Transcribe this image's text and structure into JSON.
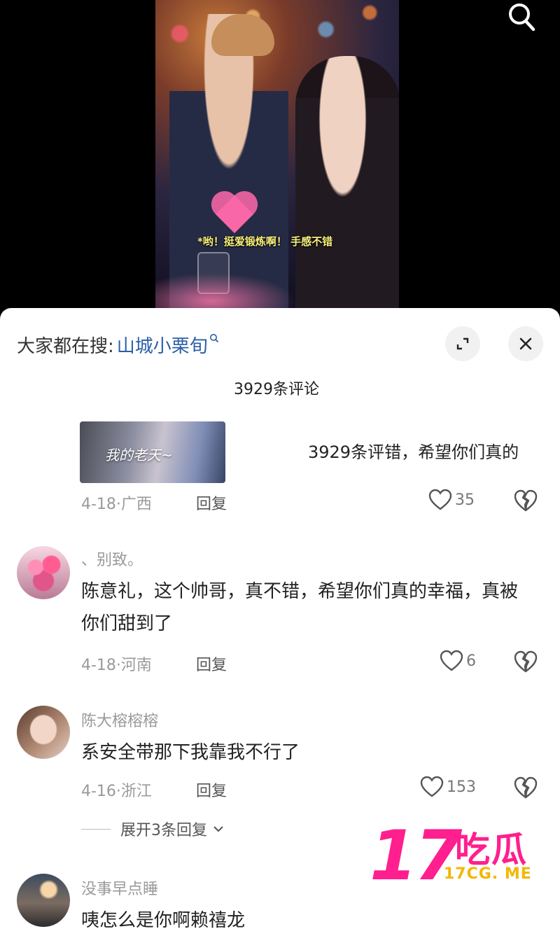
{
  "video": {
    "subtitle": "*哟！挺爱锻炼啊！ 手感不错"
  },
  "header": {
    "search_prefix": "大家都在搜:",
    "search_term": "山城小栗旬",
    "comment_count": "3929条评论"
  },
  "first_comment": {
    "thumbnail_text": "我的老天~",
    "overlay_text": "3929条评错，希望你们真的",
    "date_location": "4-18·广西",
    "reply": "回复",
    "likes": "35"
  },
  "comments": [
    {
      "username": "、别致。",
      "text": "陈意礼，这个帅哥，真不错，希望你们真的幸福，真被你们甜到了",
      "date_location": "4-18·河南",
      "reply": "回复",
      "likes": "6"
    },
    {
      "username": "陈大榕榕榕",
      "text": "系安全带那下我靠我不行了",
      "date_location": "4-16·浙江",
      "reply": "回复",
      "likes": "153",
      "expand_replies": "展开3条回复"
    },
    {
      "username": "没事早点睡",
      "text": "咦怎么是你啊赖禧龙"
    }
  ],
  "watermark": {
    "number": "17",
    "chinese": "吃瓜",
    "domain": "17CG. ME"
  },
  "icons": {
    "search": "search-icon",
    "expand": "expand-icon",
    "close": "close-icon",
    "like": "heart-icon",
    "dislike": "broken-heart-icon",
    "chevron": "chevron-down-icon"
  }
}
